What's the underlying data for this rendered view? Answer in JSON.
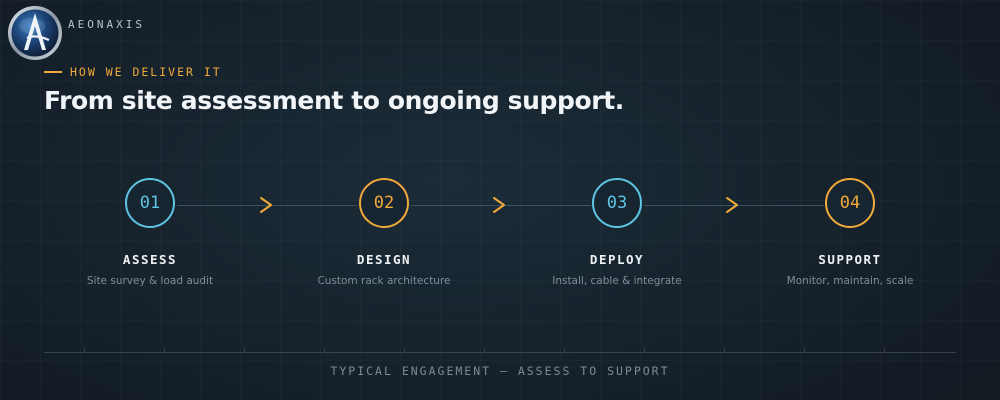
{
  "brand": {
    "name": "AEONAXIS"
  },
  "section": {
    "eyebrow": "HOW WE DELIVER IT",
    "headline": "From site assessment to ongoing support."
  },
  "steps": [
    {
      "number": "01",
      "title": "ASSESS",
      "description": "Site survey & load audit"
    },
    {
      "number": "02",
      "title": "DESIGN",
      "description": "Custom rack architecture"
    },
    {
      "number": "03",
      "title": "DEPLOY",
      "description": "Install, cable & integrate"
    },
    {
      "number": "04",
      "title": "SUPPORT",
      "description": "Monitor, maintain, scale"
    }
  ],
  "timeline": {
    "label": "TYPICAL ENGAGEMENT — ASSESS TO SUPPORT"
  },
  "colors": {
    "accent_amber": "#f0a93a",
    "accent_cyan": "#5ec4e4",
    "background": "#15202a"
  },
  "icons": {
    "logo": "aeonaxis-logo-icon",
    "step_connector": "chevron-right-icon"
  }
}
